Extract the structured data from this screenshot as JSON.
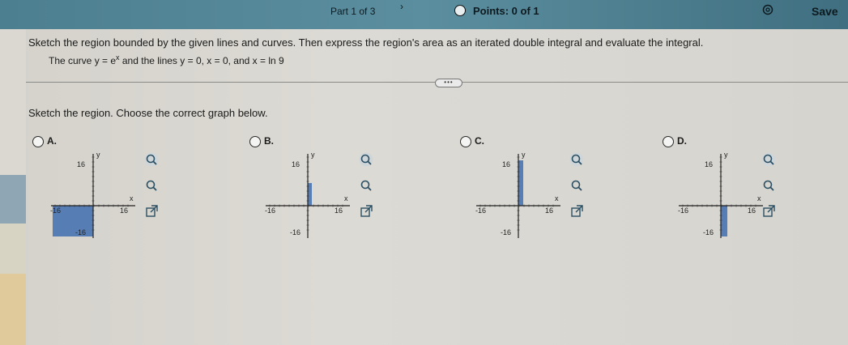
{
  "header": {
    "part": "Part 1 of 3",
    "points": "Points: 0 of 1",
    "save_label": "Save"
  },
  "question": {
    "text": "Sketch the region bounded by the given lines and curves. Then express the region's area as an iterated double integral and evaluate the integral.",
    "curve_prefix": "The curve y = e",
    "curve_exp": "x",
    "curve_suffix": " and the lines y = 0, x = 0, and x = ln 9"
  },
  "prompt": "Sketch the region. Choose the correct graph below.",
  "options": [
    {
      "label": "A.",
      "shade": "left",
      "xmax": "16",
      "xmin": "-16",
      "ymax": "16",
      "ymin": "-16",
      "xname": "x",
      "yname": "y"
    },
    {
      "label": "B.",
      "shade": "thin-right",
      "xmax": "16",
      "xmin": "-16",
      "ymax": "16",
      "ymin": "-16",
      "xname": "x",
      "yname": "y"
    },
    {
      "label": "C.",
      "shade": "thin-right-tall",
      "xmax": "16",
      "xmin": "-16",
      "ymax": "16",
      "ymin": "-16",
      "xname": "x",
      "yname": "y"
    },
    {
      "label": "D.",
      "shade": "below",
      "xmax": "16",
      "xmin": "-16",
      "ymax": "16",
      "ymin": "-16",
      "xname": "x",
      "yname": "y"
    }
  ],
  "colors": {
    "shade": "#3f6fb0",
    "curve": "#1a3e7a",
    "accent": "#4c7f90"
  }
}
